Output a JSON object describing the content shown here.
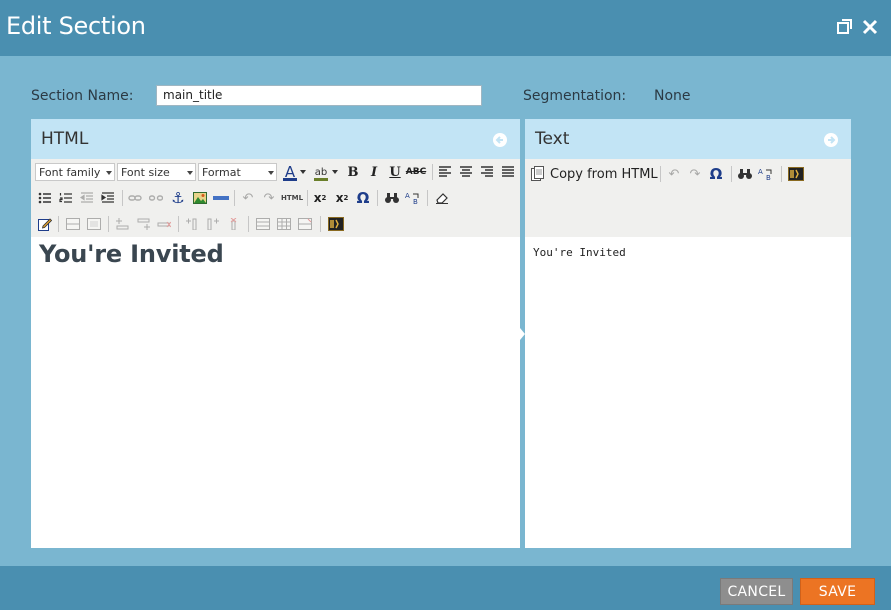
{
  "dialog": {
    "title": "Edit Section"
  },
  "form": {
    "section_name_label": "Section Name:",
    "section_name_value": "main_title",
    "segmentation_label": "Segmentation:",
    "segmentation_value": "None"
  },
  "html_panel": {
    "title": "HTML",
    "font_family": "Font family",
    "font_size": "Font size",
    "format": "Format",
    "html_btn": "HTML",
    "content_heading": "You're Invited"
  },
  "text_panel": {
    "title": "Text",
    "copy_label": "Copy from HTML",
    "content": "You're Invited"
  },
  "footer": {
    "cancel_label": "CANCEL",
    "save_label": "SAVE"
  },
  "colors": {
    "titlebar": "#4a8fb0",
    "background": "#7ab6d0",
    "panel_header": "#c2e4f5",
    "save": "#ec7423",
    "cancel": "#8e8e8e"
  }
}
